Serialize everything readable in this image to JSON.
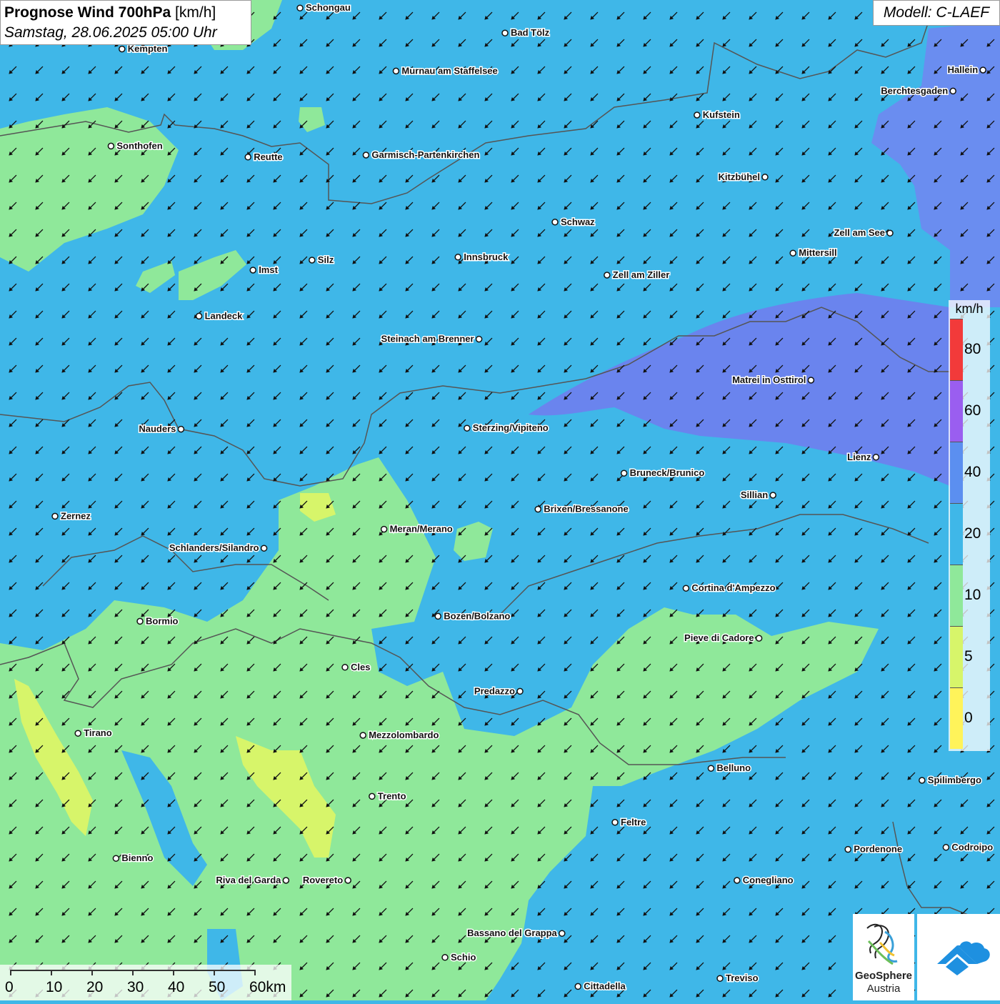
{
  "header": {
    "title": "Prognose Wind 700hPa",
    "unit": "[km/h]",
    "date": "Samstag, 28.06.2025 05:00 Uhr",
    "model": "Modell: C-LAEF"
  },
  "legend": {
    "unit": "km/h",
    "labels": [
      "0",
      "5",
      "10",
      "20",
      "40",
      "60",
      "80"
    ],
    "colors": [
      "#fff35a",
      "#d7f56a",
      "#8fe89a",
      "#3fb7e8",
      "#5b8ff0",
      "#9a5ef0",
      "#f23a3a"
    ]
  },
  "scale": {
    "labels": [
      "0",
      "10",
      "20",
      "30",
      "40",
      "50",
      "60km"
    ]
  },
  "logos": {
    "geosphere_line1": "GeoSphere",
    "geosphere_line2": "Austria"
  },
  "cities": [
    {
      "name": "Schongau",
      "lx": 0.3,
      "ly": 0.008
    },
    {
      "name": "Bad Tölz",
      "lx": 0.505,
      "ly": 0.033
    },
    {
      "name": "Kempten",
      "lx": 0.122,
      "ly": 0.049
    },
    {
      "name": "Murnau am Staffelsee",
      "lx": 0.396,
      "ly": 0.071
    },
    {
      "name": "Hallein",
      "lx": 0.983,
      "ly": 0.07,
      "left": true
    },
    {
      "name": "Berchtesgaden",
      "lx": 0.953,
      "ly": 0.091,
      "left": true
    },
    {
      "name": "Kufstein",
      "lx": 0.697,
      "ly": 0.115
    },
    {
      "name": "Sonthofen",
      "lx": 0.111,
      "ly": 0.146
    },
    {
      "name": "Reutte",
      "lx": 0.248,
      "ly": 0.157
    },
    {
      "name": "Garmisch-Partenkirchen",
      "lx": 0.366,
      "ly": 0.155
    },
    {
      "name": "Kitzbühel",
      "lx": 0.765,
      "ly": 0.177,
      "left": true
    },
    {
      "name": "Schwaz",
      "lx": 0.555,
      "ly": 0.222
    },
    {
      "name": "Zell am See",
      "lx": 0.89,
      "ly": 0.233,
      "left": true
    },
    {
      "name": "Mittersill",
      "lx": 0.793,
      "ly": 0.253
    },
    {
      "name": "Innsbruck",
      "lx": 0.458,
      "ly": 0.257
    },
    {
      "name": "Silz",
      "lx": 0.312,
      "ly": 0.26
    },
    {
      "name": "Imst",
      "lx": 0.253,
      "ly": 0.27
    },
    {
      "name": "Zell am Ziller",
      "lx": 0.607,
      "ly": 0.275
    },
    {
      "name": "Landeck",
      "lx": 0.199,
      "ly": 0.316
    },
    {
      "name": "Steinach am Brenner",
      "lx": 0.479,
      "ly": 0.339,
      "left": true
    },
    {
      "name": "Matrei in Osttirol",
      "lx": 0.811,
      "ly": 0.38,
      "left": true
    },
    {
      "name": "Nauders",
      "lx": 0.181,
      "ly": 0.429,
      "left": true
    },
    {
      "name": "Sterzing/Vipiteno",
      "lx": 0.467,
      "ly": 0.428
    },
    {
      "name": "Lienz",
      "lx": 0.876,
      "ly": 0.457,
      "left": true
    },
    {
      "name": "Bruneck/Brunico",
      "lx": 0.624,
      "ly": 0.473
    },
    {
      "name": "Sillian",
      "lx": 0.773,
      "ly": 0.495,
      "left": true
    },
    {
      "name": "Brixen/Bressanone",
      "lx": 0.538,
      "ly": 0.509
    },
    {
      "name": "Zernez",
      "lx": 0.055,
      "ly": 0.516
    },
    {
      "name": "Meran/Merano",
      "lx": 0.384,
      "ly": 0.529
    },
    {
      "name": "Schlanders/Silandro",
      "lx": 0.264,
      "ly": 0.548,
      "left": true
    },
    {
      "name": "Cortina d'Ampezzo",
      "lx": 0.686,
      "ly": 0.588
    },
    {
      "name": "Bozen/Bolzano",
      "lx": 0.438,
      "ly": 0.616
    },
    {
      "name": "Bormio",
      "lx": 0.14,
      "ly": 0.621
    },
    {
      "name": "Pieve di Cadore",
      "lx": 0.759,
      "ly": 0.638,
      "left": true
    },
    {
      "name": "Cles",
      "lx": 0.345,
      "ly": 0.667
    },
    {
      "name": "Predazzo",
      "lx": 0.52,
      "ly": 0.691,
      "left": true
    },
    {
      "name": "Tirano",
      "lx": 0.078,
      "ly": 0.733
    },
    {
      "name": "Mezzolombardo",
      "lx": 0.363,
      "ly": 0.735
    },
    {
      "name": "Belluno",
      "lx": 0.711,
      "ly": 0.768
    },
    {
      "name": "Spilimbergo",
      "lx": 0.922,
      "ly": 0.78
    },
    {
      "name": "Trento",
      "lx": 0.372,
      "ly": 0.796
    },
    {
      "name": "Feltre",
      "lx": 0.615,
      "ly": 0.822
    },
    {
      "name": "Pordenone",
      "lx": 0.848,
      "ly": 0.849
    },
    {
      "name": "Codroipo",
      "lx": 0.946,
      "ly": 0.847
    },
    {
      "name": "Bienno",
      "lx": 0.116,
      "ly": 0.858
    },
    {
      "name": "Riva del Garda",
      "lx": 0.286,
      "ly": 0.88,
      "left": true
    },
    {
      "name": "Rovereto",
      "lx": 0.348,
      "ly": 0.88,
      "left": true
    },
    {
      "name": "Conegliano",
      "lx": 0.737,
      "ly": 0.88
    },
    {
      "name": "Bassano del Grappa",
      "lx": 0.562,
      "ly": 0.933,
      "left": true
    },
    {
      "name": "Schio",
      "lx": 0.445,
      "ly": 0.957
    },
    {
      "name": "Treviso",
      "lx": 0.72,
      "ly": 0.978
    },
    {
      "name": "Cittadella",
      "lx": 0.578,
      "ly": 0.986
    }
  ]
}
